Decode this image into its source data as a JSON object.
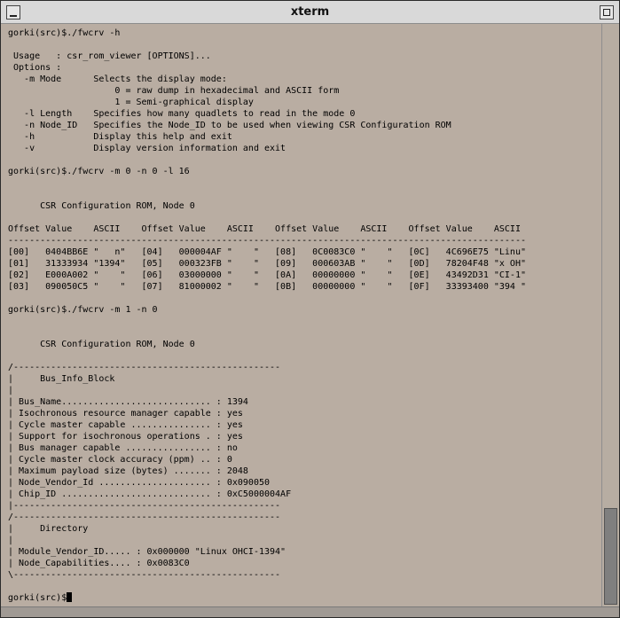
{
  "window": {
    "title": "xterm"
  },
  "terminal": {
    "lines": [
      "gorki(src)$./fwcrv -h",
      "",
      " Usage   : csr_rom_viewer [OPTIONS]...",
      " Options :",
      "   -m Mode      Selects the display mode:",
      "                    0 = raw dump in hexadecimal and ASCII form",
      "                    1 = Semi-graphical display",
      "   -l Length    Specifies how many quadlets to read in the mode 0",
      "   -n Node_ID   Specifies the Node_ID to be used when viewing CSR Configuration ROM",
      "   -h           Display this help and exit",
      "   -v           Display version information and exit",
      "",
      "gorki(src)$./fwcrv -m 0 -n 0 -l 16",
      "",
      "",
      "      CSR Configuration ROM, Node 0",
      "",
      "Offset Value    ASCII    Offset Value    ASCII    Offset Value    ASCII    Offset Value    ASCII",
      "-------------------------------------------------------------------------------------------------",
      "[00]   0404BB6E \"   n\"   [04]   000004AF \"    \"   [08]   0C0083C0 \"    \"   [0C]   4C696E75 \"Linu\"",
      "[01]   31333934 \"1394\"   [05]   000323FB \"    \"   [09]   000603AB \"    \"   [0D]   78204F48 \"x OH\"",
      "[02]   E000A002 \"    \"   [06]   03000000 \"    \"   [0A]   00000000 \"    \"   [0E]   43492D31 \"CI-1\"",
      "[03]   090050C5 \"    \"   [07]   81000002 \"    \"   [0B]   00000000 \"    \"   [0F]   33393400 \"394 \"",
      "",
      "gorki(src)$./fwcrv -m 1 -n 0",
      "",
      "",
      "      CSR Configuration ROM, Node 0",
      "",
      "/--------------------------------------------------",
      "|     Bus_Info_Block",
      "|",
      "| Bus_Name............................ : 1394",
      "| Isochronous resource manager capable : yes",
      "| Cycle master capable ............... : yes",
      "| Support for isochronous operations . : yes",
      "| Bus manager capable ................ : no",
      "| Cycle master clock accuracy (ppm) .. : 0",
      "| Maximum payload size (bytes) ....... : 2048",
      "| Node_Vendor_Id ..................... : 0x090050",
      "| Chip_ID ............................ : 0xC5000004AF",
      "|--------------------------------------------------",
      "/--------------------------------------------------",
      "|     Directory",
      "|",
      "| Module_Vendor_ID..... : 0x000000 \"Linux OHCI-1394\"",
      "| Node_Capabilities.... : 0x0083C0",
      "\\--------------------------------------------------",
      ""
    ],
    "prompt": "gorki(src)$"
  }
}
